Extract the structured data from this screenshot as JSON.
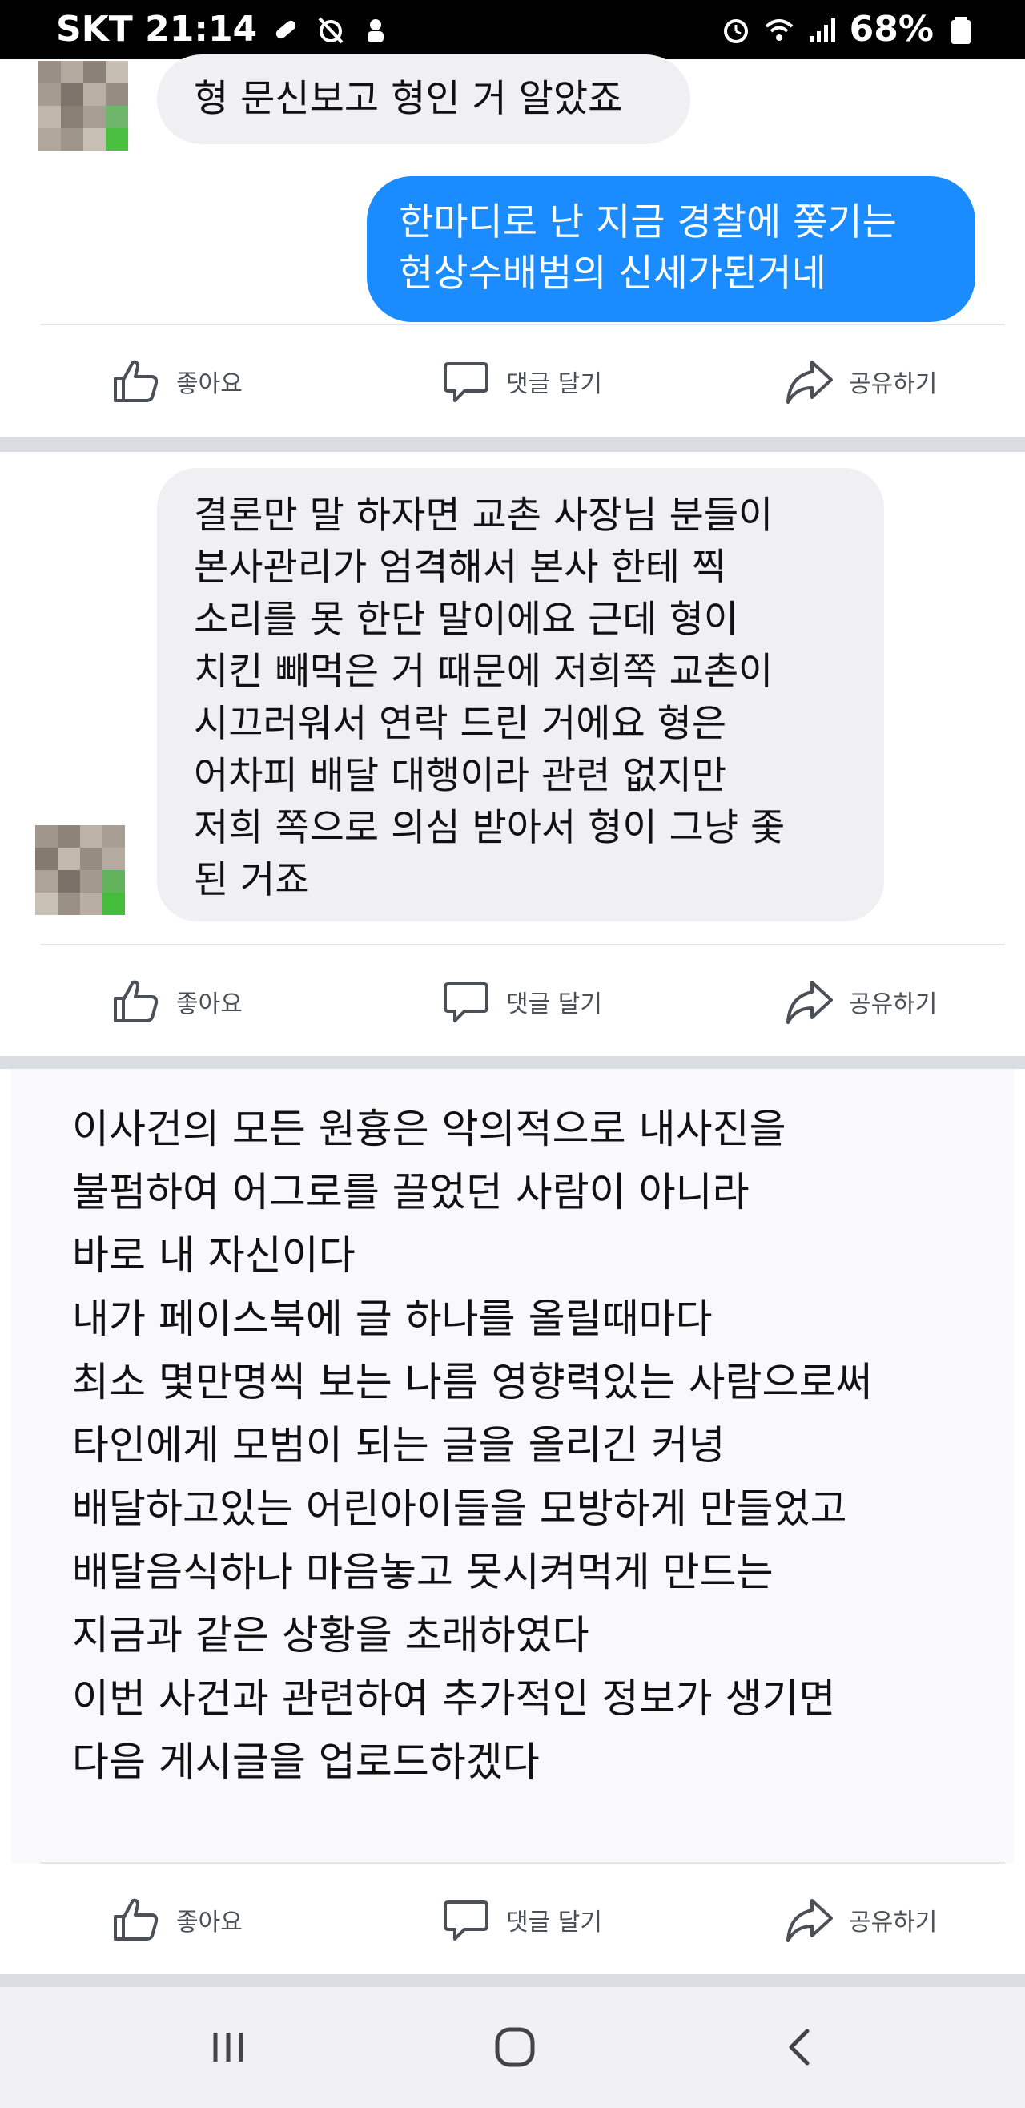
{
  "status_bar": {
    "carrier_time": "SKT 21:14",
    "battery": "68%"
  },
  "messages": [
    {
      "id": "m1",
      "side": "incoming",
      "lines": [
        "형 문신보고 형인 거 알았죠"
      ]
    },
    {
      "id": "m2",
      "side": "outgoing",
      "lines": [
        "한마디로 난 지금 경찰에 쫒기는",
        "현상수배범의 신세가된거네"
      ]
    },
    {
      "id": "m3",
      "side": "incoming",
      "lines": [
        "결론만 말 하자면 교촌 사장님 분들이",
        "본사관리가 엄격해서 본사 한테 찍",
        "소리를 못 한단 말이에요 근데 형이",
        "치킨 빼먹은 거 때문에 저희쪽 교촌이",
        "시끄러워서 연락 드린 거에요 형은",
        "어차피 배달 대행이라 관련 없지만",
        "저희 쪽으로 의심 받아서 형이 그냥 좇",
        "된 거죠"
      ]
    }
  ],
  "post_text_lines": [
    "이사건의 모든 원흉은 악의적으로 내사진을",
    "불펌하여 어그로를 끌었던 사람이 아니라",
    "바로 내 자신이다",
    "내가 페이스북에 글 하나를 올릴때마다",
    "최소 몇만명씩 보는 나름 영향력있는 사람으로써",
    "타인에게 모범이 되는 글을 올리긴 커녕",
    "배달하고있는 어린아이들을 모방하게 만들었고",
    "배달음식하나 마음놓고 못시켜먹게 만드는",
    "지금과 같은 상황을 초래하였다",
    "이번 사건과 관련하여 추가적인 정보가 생기면",
    "다음 게시글을 업로드하겠다"
  ],
  "actions": {
    "like": "좋아요",
    "comment": "댓글 달기",
    "share": "공유하기"
  },
  "icons": {
    "like": "thumbs-up-icon",
    "comment": "comment-bubble-icon",
    "share": "share-arrow-icon",
    "nav_recent": "recent-apps-icon",
    "nav_home": "home-icon",
    "nav_back": "back-icon"
  },
  "colors": {
    "outgoing_bubble": "#1a8cff",
    "incoming_bubble": "#f0f0f2",
    "action_text": "#4b4f56",
    "status_bar": "#000000"
  }
}
